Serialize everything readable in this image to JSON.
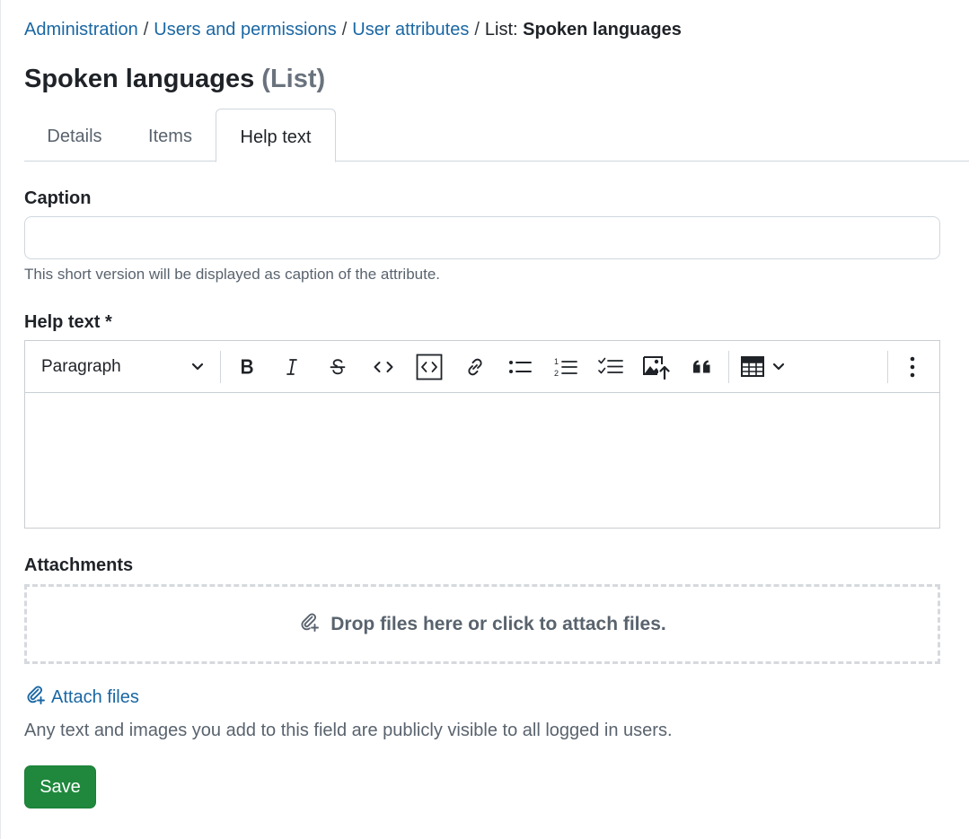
{
  "breadcrumb": {
    "items": [
      "Administration",
      "Users and permissions",
      "User attributes"
    ],
    "separator": "/",
    "current_prefix": "List:",
    "current": "Spoken languages"
  },
  "page": {
    "title": "Spoken languages",
    "title_suffix": "(List)"
  },
  "tabs": [
    {
      "label": "Details",
      "active": false
    },
    {
      "label": "Items",
      "active": false
    },
    {
      "label": "Help text",
      "active": true
    }
  ],
  "form": {
    "caption_label": "Caption",
    "caption_value": "",
    "caption_hint": "This short version will be displayed as caption of the attribute.",
    "help_text_label": "Help text *",
    "editor": {
      "paragraph_select": "Paragraph",
      "toolbar_icons": [
        "bold-icon",
        "italic-icon",
        "strikethrough-icon",
        "code-icon",
        "code-block-icon",
        "link-icon",
        "bulleted-list-icon",
        "numbered-list-icon",
        "todo-list-icon",
        "image-upload-icon",
        "blockquote-icon",
        "table-icon",
        "more-options-icon"
      ],
      "content": ""
    },
    "attachments_label": "Attachments",
    "dropzone_text": "Drop files here or click to attach files.",
    "attach_link": "Attach files",
    "visibility_notice": "Any text and images you add to this field are publicly visible to all logged in users.",
    "save_label": "Save"
  },
  "colors": {
    "link": "#1a67a3",
    "save_button": "#1f883d",
    "muted_text": "#59636e"
  }
}
